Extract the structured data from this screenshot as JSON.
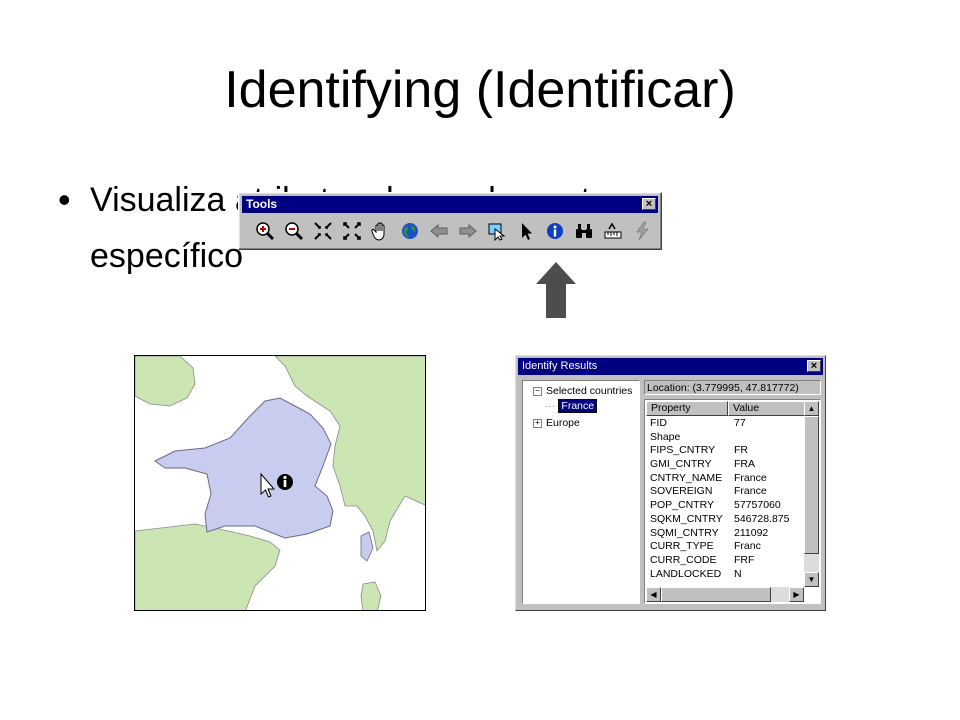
{
  "slide": {
    "title": "Identifying (Identificar)",
    "bullet_line1": "Visualiza atributos de un elemento",
    "bullet_line2": "específico"
  },
  "tools": {
    "title": "Tools",
    "close_glyph": "×",
    "buttons": [
      {
        "name": "zoom-in-icon"
      },
      {
        "name": "zoom-out-icon"
      },
      {
        "name": "fixed-zoom-in-icon"
      },
      {
        "name": "fixed-zoom-out-icon"
      },
      {
        "name": "pan-hand-icon"
      },
      {
        "name": "full-extent-globe-icon"
      },
      {
        "name": "back-arrow-icon"
      },
      {
        "name": "forward-arrow-icon"
      },
      {
        "name": "select-features-icon"
      },
      {
        "name": "select-pointer-icon"
      },
      {
        "name": "identify-info-icon"
      },
      {
        "name": "find-binoculars-icon"
      },
      {
        "name": "measure-icon"
      },
      {
        "name": "hyperlink-lightning-icon"
      }
    ]
  },
  "identify": {
    "title": "Identify Results",
    "close_glyph": "×",
    "tree": {
      "root_label": "Selected countries",
      "root_toggle": "−",
      "child_label": "France",
      "second_label": "Europe",
      "second_toggle": "+"
    },
    "location": "Location: (3.779995, 47.817772)",
    "columns": [
      "Property",
      "Value"
    ],
    "rows": [
      [
        "FID",
        "77"
      ],
      [
        "Shape",
        ""
      ],
      [
        "FIPS_CNTRY",
        "FR"
      ],
      [
        "GMI_CNTRY",
        "FRA"
      ],
      [
        "CNTRY_NAME",
        "France"
      ],
      [
        "SOVEREIGN",
        "France"
      ],
      [
        "POP_CNTRY",
        "57757060"
      ],
      [
        "SQKM_CNTRY",
        "546728.875"
      ],
      [
        "SQMI_CNTRY",
        "211092"
      ],
      [
        "CURR_TYPE",
        "Franc"
      ],
      [
        "CURR_CODE",
        "FRF"
      ],
      [
        "LANDLOCKED",
        "N"
      ]
    ],
    "scroll_up": "▲",
    "scroll_down": "▼",
    "scroll_left": "◀",
    "scroll_right": "▶"
  },
  "colors": {
    "titlebar": "#000080",
    "land": "#cce6b3",
    "sea": "#ffffff",
    "france_selected": "#c8ccee"
  }
}
